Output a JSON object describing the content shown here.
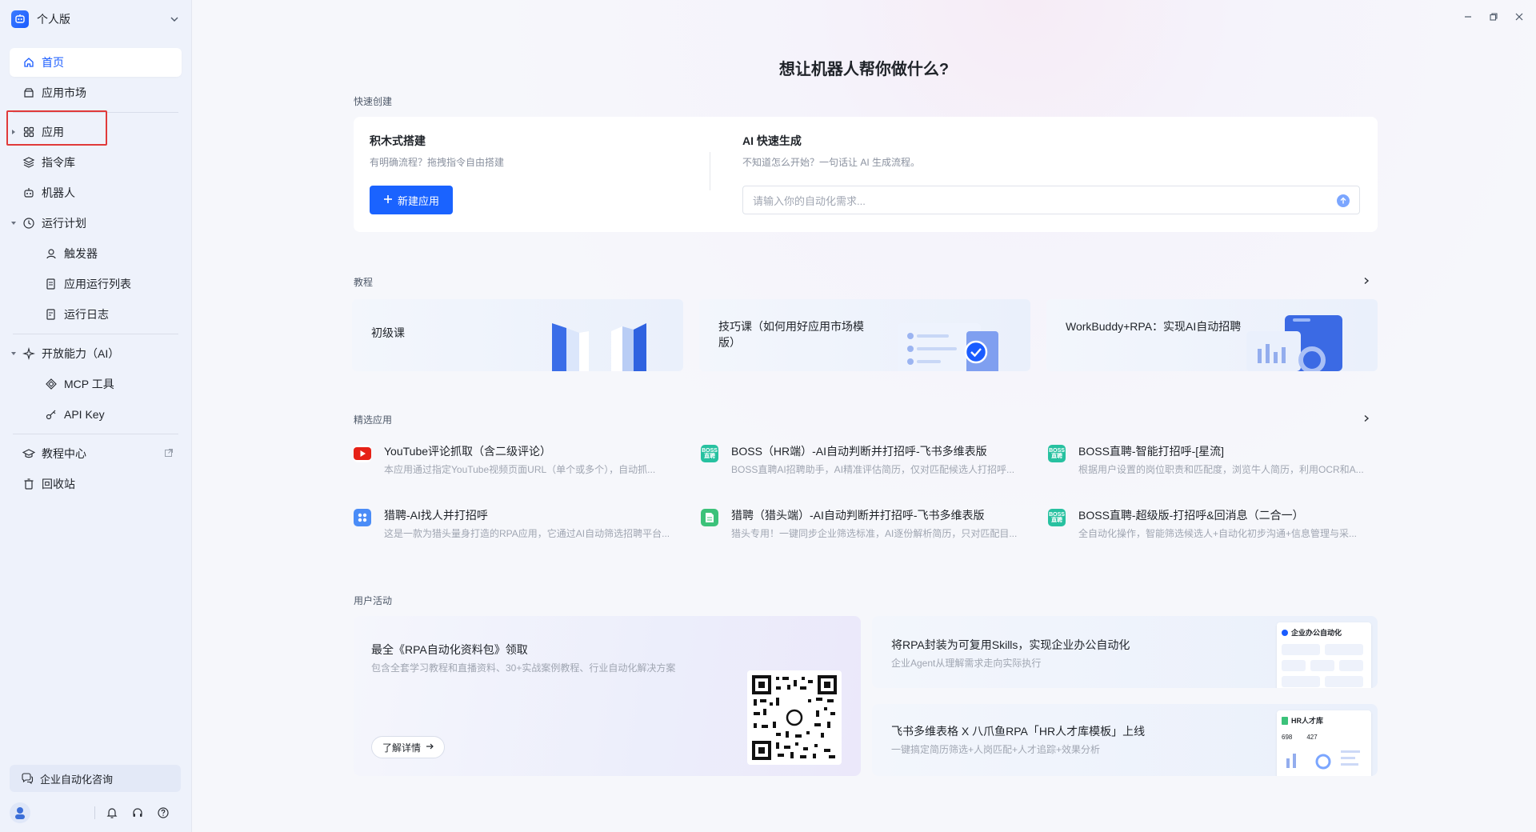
{
  "brand": {
    "name": "个人版"
  },
  "sidebar": {
    "items": [
      {
        "label": "首页"
      },
      {
        "label": "应用市场"
      },
      {
        "label": "应用"
      },
      {
        "label": "指令库"
      },
      {
        "label": "机器人"
      },
      {
        "label": "运行计划"
      },
      {
        "label": "触发器"
      },
      {
        "label": "应用运行列表"
      },
      {
        "label": "运行日志"
      },
      {
        "label": "开放能力（AI）"
      },
      {
        "label": "MCP 工具"
      },
      {
        "label": "API Key"
      },
      {
        "label": "教程中心"
      },
      {
        "label": "回收站"
      }
    ],
    "consult": "企业自动化咨询"
  },
  "hero": {
    "title": "想让机器人帮你做什么?"
  },
  "quick": {
    "section": "快速创建",
    "left_title": "积木式搭建",
    "left_sub": "有明确流程？拖拽指令自由搭建",
    "new_button": "新建应用",
    "right_title": "AI 快速生成",
    "right_sub": "不知道怎么开始？一句话让 AI 生成流程。",
    "input_placeholder": "请输入你的自动化需求..."
  },
  "tutorials": {
    "section": "教程",
    "cards": [
      {
        "title": "初级课"
      },
      {
        "title": "技巧课（如何用好应用市场模版）"
      },
      {
        "title": "WorkBuddy+RPA：实现AI自动招聘"
      }
    ]
  },
  "featured": {
    "section": "精选应用",
    "apps": [
      {
        "name": "YouTube评论抓取（含二级评论）",
        "desc": "本应用通过指定YouTube视频页面URL（单个或多个），自动抓...",
        "icon": "youtube-icon",
        "color": "#e62117"
      },
      {
        "name": "BOSS（HR端）-AI自动判断并打招呼-飞书多维表版",
        "desc": "BOSS直聘AI招聘助手，AI精准评估简历，仅对匹配候选人打招呼...",
        "icon": "boss-icon",
        "color": "#27c1a0"
      },
      {
        "name": "BOSS直聘-智能打招呼-[星流]",
        "desc": "根据用户设置的岗位职责和匹配度，浏览牛人简历，利用OCR和A...",
        "icon": "boss-icon",
        "color": "#27c1a0"
      },
      {
        "name": "猎聘-AI找人并打招呼",
        "desc": "这是一款为猎头量身打造的RPA应用，它通过AI自动筛选招聘平台...",
        "icon": "grid-app-icon",
        "color": "#4a8cf7"
      },
      {
        "name": "猎聘（猎头端）-AI自动判断并打招呼-飞书多维表版",
        "desc": "猎头专用！一键同步企业筛选标准，AI逐份解析简历，只对匹配目...",
        "icon": "sheet-icon",
        "color": "#3cc27a"
      },
      {
        "name": "BOSS直聘-超级版-打招呼&回消息（二合一）",
        "desc": "全自动化操作，智能筛选候选人+自动化初步沟通+信息管理与采...",
        "icon": "boss-icon",
        "color": "#27c1a0"
      }
    ]
  },
  "activity": {
    "section": "用户活动",
    "left": {
      "title": "最全《RPA自动化资料包》领取",
      "sub": "包含全套学习教程和直播资料、30+实战案例教程、行业自动化解决方案",
      "button": "了解详情"
    },
    "right": [
      {
        "title": "将RPA封装为可复用Skills，实现企业办公自动化",
        "sub": "企业Agent从理解需求走向实际执行",
        "card_title": "企业办公自动化"
      },
      {
        "title": "飞书多维表格 X 八爪鱼RPA「HR人才库模板」上线",
        "sub": "一键搞定简历筛选+人岗匹配+人才追踪+效果分析",
        "card_title": "HR人才库",
        "card_nums": [
          "698",
          "427"
        ]
      }
    ]
  }
}
